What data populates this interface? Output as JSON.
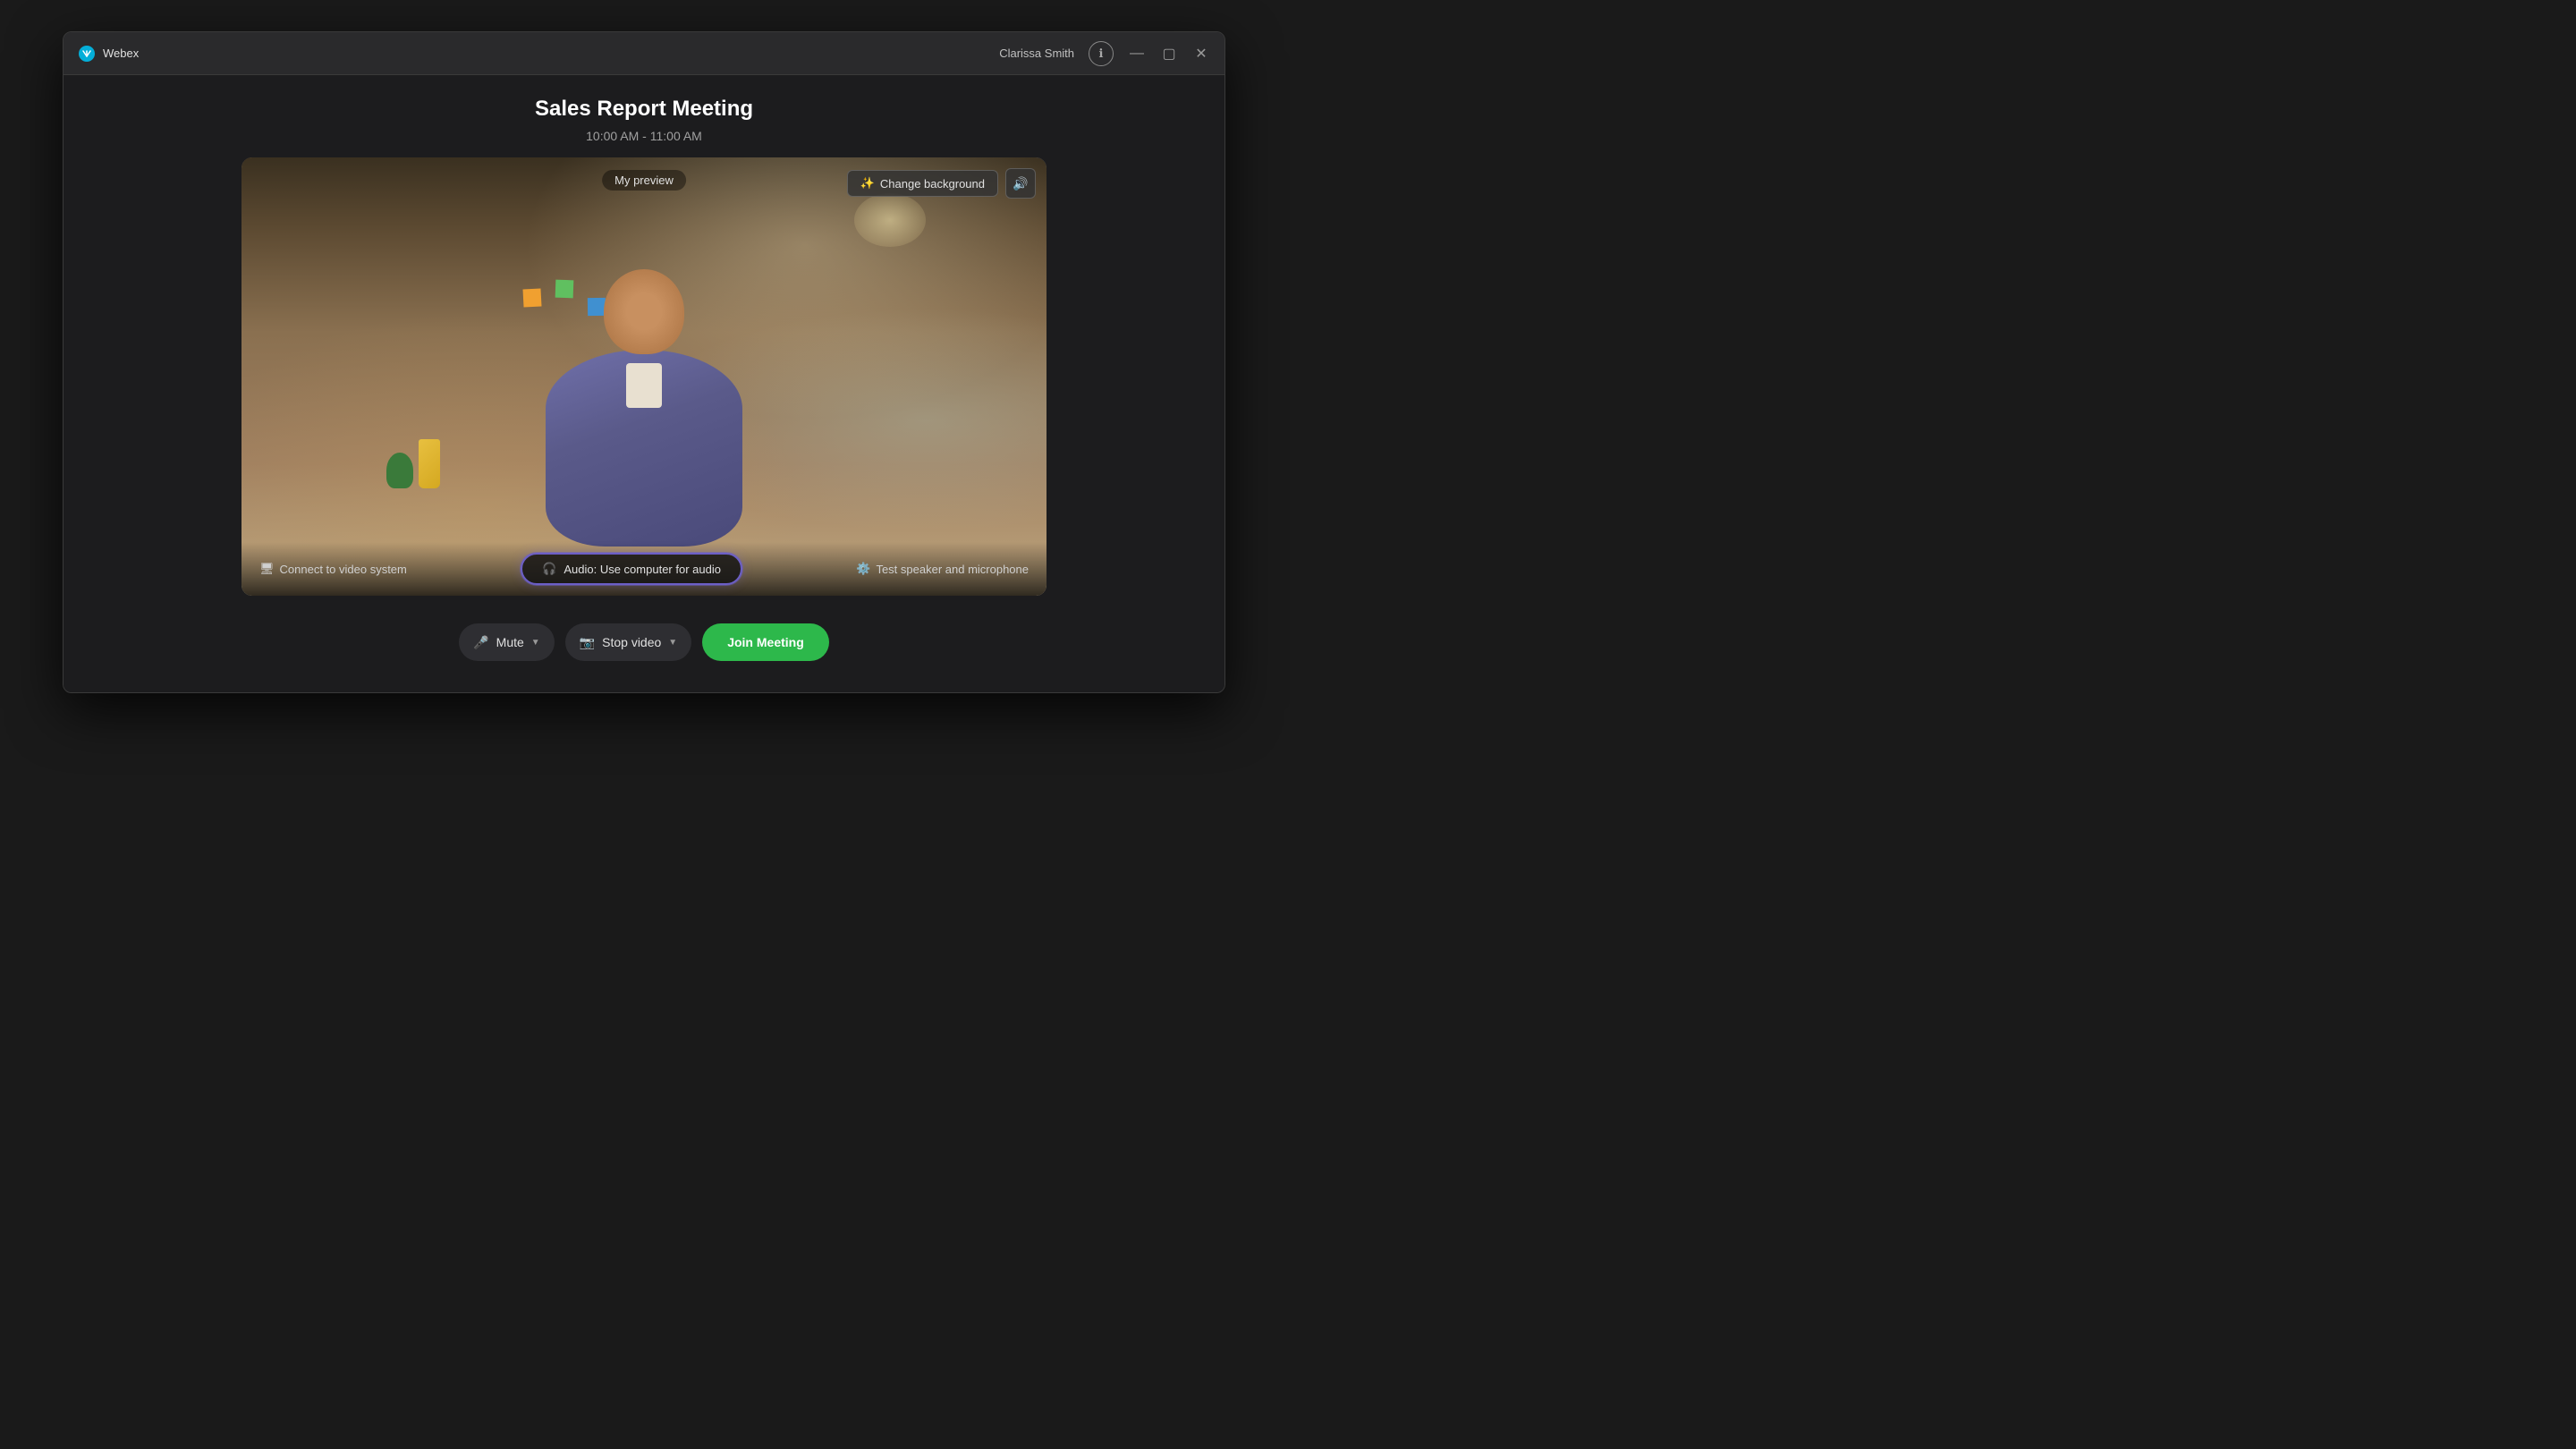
{
  "app": {
    "name": "Webex"
  },
  "titlebar": {
    "user_name": "Clarissa Smith",
    "info_icon": "ℹ",
    "minimize_icon": "—",
    "maximize_icon": "▢",
    "close_icon": "✕"
  },
  "meeting": {
    "title": "Sales Report Meeting",
    "time": "10:00 AM - 11:00 AM"
  },
  "preview": {
    "label": "My preview",
    "change_background_label": "Change background",
    "connect_video_label": "Connect to video system",
    "audio_label": "Audio: Use computer for audio",
    "test_speaker_label": "Test speaker and microphone"
  },
  "controls": {
    "mute_label": "Mute",
    "stop_video_label": "Stop video",
    "join_label": "Join Meeting"
  },
  "colors": {
    "join_green": "#2db84b",
    "audio_purple": "#6c5fc7",
    "window_bg": "#1c1c1e",
    "titlebar_bg": "#2a2a2c"
  }
}
